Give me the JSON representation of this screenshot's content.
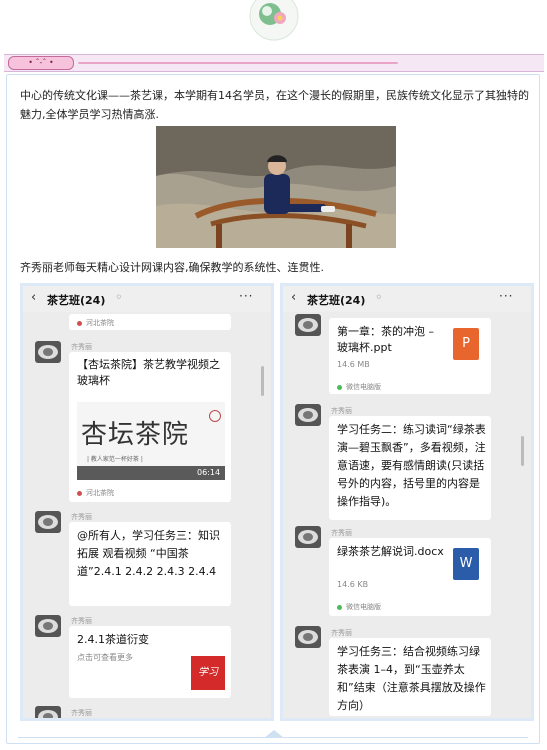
{
  "intro_text": "中心的传统文化课——茶艺课，本学期有14名学员，在这个漫长的假期里，民族传统文化显示了其独特的魅力,全体学员学习热情高涨.",
  "second_text": "齐秀丽老师每天精心设计网课内容,确保教学的系统性、连贯性.",
  "header_tag": "• ˆ-ˆ •",
  "colors": {
    "accent": "#e9a4c7",
    "frame": "#cfe0f2"
  },
  "left_panel": {
    "back_icon": "back-chevron-icon",
    "title": "茶艺班(24)",
    "more": "···",
    "source_top": "河北茶院",
    "msg1": {
      "sender": "齐秀丽",
      "text": "【杏坛茶院】茶艺教学视频之玻璃杯",
      "video_title": "杏坛茶院",
      "video_sub": "| 教人家范一杯好茶 |",
      "duration": "06:14",
      "source": "河北茶院"
    },
    "msg2": {
      "sender": "齐秀丽",
      "text": "@所有人，学习任务三：知识拓展 观看视频 “中国茶道”2.4.1  2.4.2  2.4.3  2.4.4"
    },
    "msg3": {
      "sender": "齐秀丽",
      "title": "2.4.1茶道衍变",
      "subtitle": "点击可查看更多",
      "thumb_text": "学习"
    },
    "msg4": {
      "sender": "齐秀丽"
    }
  },
  "right_panel": {
    "back_icon": "back-chevron-icon",
    "title": "茶艺班(24)",
    "more": "···",
    "file1": {
      "name": "第一章：茶的冲泡 – 玻璃杯.ppt",
      "size": "14.6 MB",
      "icon_letter": "P",
      "source": "微信电脑版"
    },
    "msg2": {
      "sender": "齐秀丽",
      "text": "学习任务二：练习读词“绿茶表演—碧玉飘香”，多看视频，注意语速，要有感情朗读(只读括号外的内容，括号里的内容是操作指导)。"
    },
    "file2": {
      "sender": "齐秀丽",
      "name": "绿茶茶艺解说词.docx",
      "size": "14.6 KB",
      "icon_letter": "W",
      "source": "微信电脑版"
    },
    "msg4": {
      "sender": "齐秀丽",
      "text": "学习任务三：结合视频练习绿茶表演 1–4，到“玉壶养太和”结束（注意茶具摆放及操作方向）"
    }
  }
}
